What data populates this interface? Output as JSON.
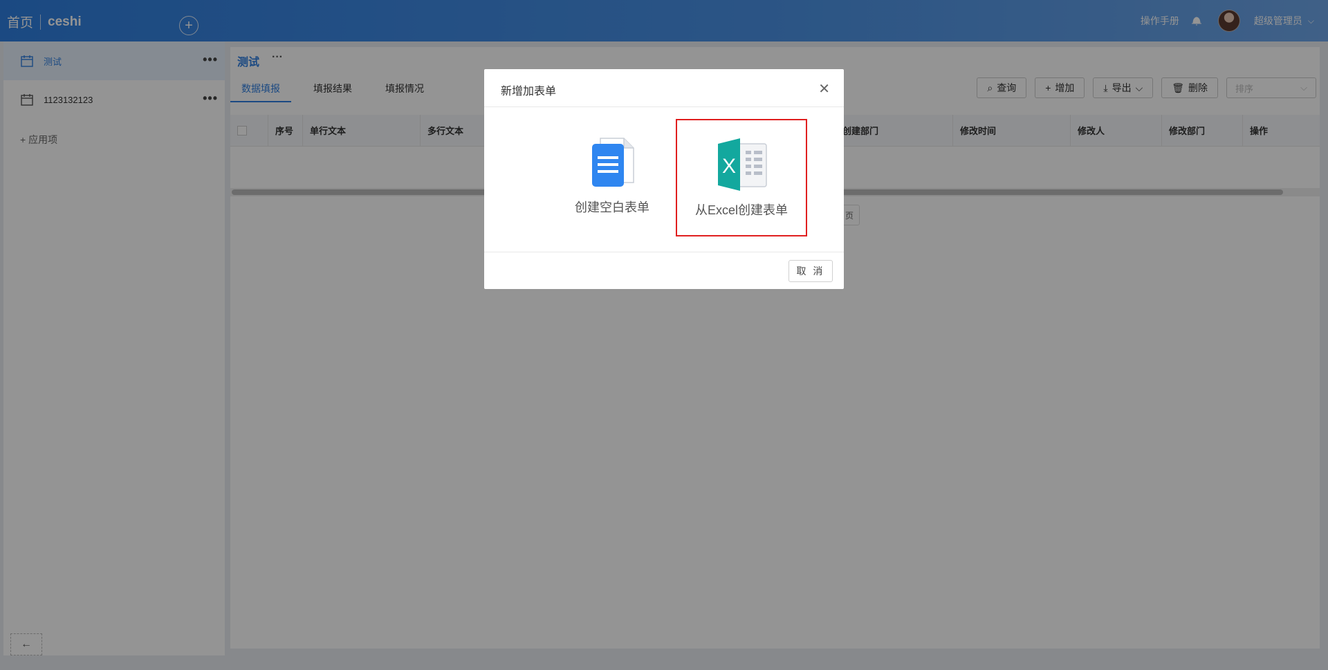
{
  "header": {
    "home": "首页",
    "app_name": "ceshi",
    "manual": "操作手册",
    "user": "超级管理员"
  },
  "sidebar": {
    "items": [
      {
        "label": "测试",
        "active": true
      },
      {
        "label": "1123132123",
        "active": false
      }
    ],
    "add_label": "+ 应用项"
  },
  "main": {
    "title": "测试",
    "tabs": [
      "数据填报",
      "填报结果",
      "填报情况"
    ],
    "toolbar": {
      "query": "查询",
      "add": "增加",
      "export": "导出",
      "delete": "删除",
      "sort_placeholder": "排序"
    },
    "columns": [
      "序号",
      "单行文本",
      "多行文本",
      "创建部门",
      "修改时间",
      "修改人",
      "修改部门",
      "操作"
    ],
    "pager_fragment": "页"
  },
  "modal": {
    "title": "新增加表单",
    "options": [
      {
        "label": "创建空白表单",
        "icon": "document-icon"
      },
      {
        "label": "从Excel创建表单",
        "icon": "excel-icon",
        "highlighted": true,
        "highlight_color": "#e01e1e"
      }
    ],
    "cancel": "取 消"
  },
  "colors": {
    "accent": "#2f7fe0",
    "excel_green": "#13a89e",
    "doc_blue": "#2f86f0"
  }
}
